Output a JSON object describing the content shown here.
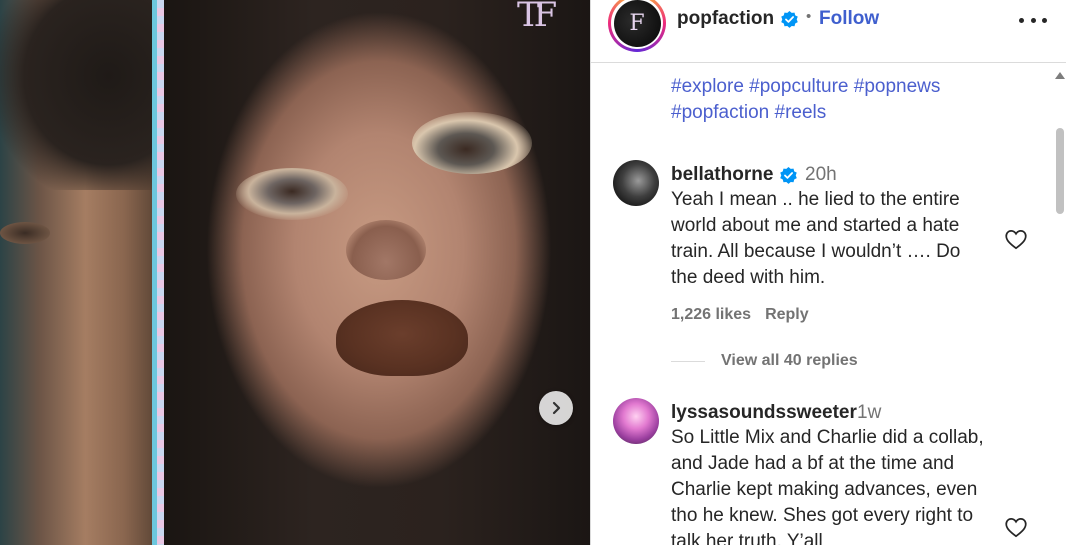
{
  "post": {
    "author": "popfaction",
    "author_avatar_text": "F",
    "follow_label": "Follow",
    "separator": "•",
    "hashtags": [
      "#explore",
      "#popculture",
      "#popnews",
      "#popfaction",
      "#reels"
    ]
  },
  "comments": [
    {
      "user": "bellathorne",
      "verified": true,
      "time": "20h",
      "text": "Yeah I mean .. he lied to the entire world about me and started a hate train. All because I wouldn’t …. Do the deed with him.",
      "likes": "1,226 likes",
      "reply_label": "Reply",
      "view_replies": "View all 40 replies"
    },
    {
      "user": "lyssasoundssweeter",
      "verified": false,
      "time": "1w",
      "text": "So Little Mix and Charlie did a collab, and Jade had a bf at the time and Charlie kept making advances, even tho he knew. Shes got every right to talk her truth. Y’all"
    }
  ],
  "icons": {
    "next": "chevron-right-icon",
    "more": "more-options-icon",
    "verified": "verified-badge-icon",
    "like": "heart-icon"
  },
  "colors": {
    "link": "#4b5fce",
    "verified": "#0095f6",
    "muted": "#737373"
  }
}
